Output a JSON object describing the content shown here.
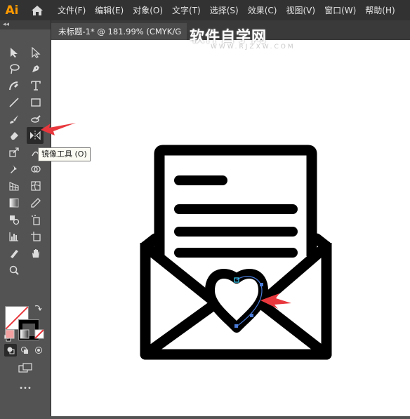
{
  "app": {
    "logo_text": "Ai"
  },
  "menu": {
    "items": [
      "文件(F)",
      "编辑(E)",
      "对象(O)",
      "文字(T)",
      "选择(S)",
      "效果(C)",
      "视图(V)",
      "窗口(W)",
      "帮助(H)"
    ]
  },
  "document": {
    "tab_title": "未标题-1* @ 181.99% (CMYK/G"
  },
  "watermark": {
    "text": "软件自学网",
    "sub": "WWW.RJZXW.COM"
  },
  "tooltip": {
    "text": "镜像工具 (O)"
  },
  "toolbar": {
    "collapse_label": "◂◂",
    "more_label": "•••"
  },
  "colors": {
    "accent": "#ff9a00",
    "arrow": "#e8383d",
    "selection": "#4a7bd8",
    "anchor_highlight": "#35c6ec"
  }
}
